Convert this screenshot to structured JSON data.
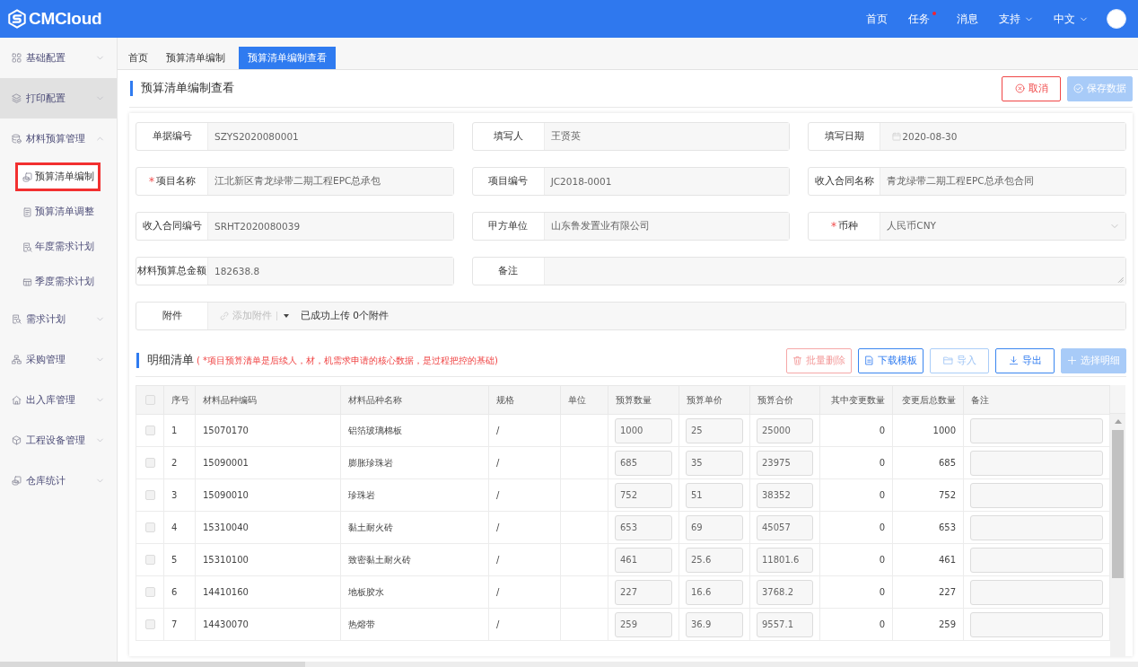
{
  "header": {
    "logo": "CMCloud",
    "nav": [
      {
        "label": "首页",
        "badge": false,
        "dropdown": false
      },
      {
        "label": "任务",
        "badge": true,
        "dropdown": false
      },
      {
        "label": "消息",
        "badge": false,
        "dropdown": false
      },
      {
        "label": "支持",
        "badge": false,
        "dropdown": true
      },
      {
        "label": "中文",
        "badge": false,
        "dropdown": true
      }
    ]
  },
  "sidebar": {
    "items": [
      {
        "label": "基础配置",
        "expanded": false,
        "hovered": false
      },
      {
        "label": "打印配置",
        "expanded": false,
        "hovered": true
      },
      {
        "label": "材料预算管理",
        "expanded": true,
        "hovered": false,
        "children": [
          {
            "label": "预算清单编制",
            "selected": true,
            "outlined": true
          },
          {
            "label": "预算清单调整",
            "selected": false,
            "outlined": false
          },
          {
            "label": "年度需求计划",
            "selected": false,
            "outlined": false
          },
          {
            "label": "季度需求计划",
            "selected": false,
            "outlined": false
          }
        ]
      },
      {
        "label": "需求计划",
        "expanded": false,
        "hovered": false
      },
      {
        "label": "采购管理",
        "expanded": false,
        "hovered": false
      },
      {
        "label": "出入库管理",
        "expanded": false,
        "hovered": false
      },
      {
        "label": "工程设备管理",
        "expanded": false,
        "hovered": false
      },
      {
        "label": "仓库统计",
        "expanded": false,
        "hovered": false
      }
    ]
  },
  "tabs": [
    {
      "label": "首页",
      "selected": false
    },
    {
      "label": "预算清单编制",
      "selected": false
    },
    {
      "label": "预算清单编制查看",
      "selected": true
    }
  ],
  "page": {
    "title": "预算清单编制查看",
    "actions": [
      {
        "label": "取消",
        "kind": "danger",
        "disabled": false
      },
      {
        "label": "保存数据",
        "kind": "solid",
        "disabled": true
      }
    ]
  },
  "form": {
    "fields": [
      {
        "label": "单据编号",
        "value": "SZYS2020080001",
        "required": false,
        "kind": "text"
      },
      {
        "label": "填写人",
        "value": "王贤英",
        "required": false,
        "kind": "text"
      },
      {
        "label": "填写日期",
        "value": "2020-08-30",
        "required": false,
        "kind": "date"
      },
      {
        "label": "项目名称",
        "value": "江北新区青龙绿带二期工程EPC总承包",
        "required": true,
        "kind": "text"
      },
      {
        "label": "项目编号",
        "value": "JC2018-0001",
        "required": false,
        "kind": "text"
      },
      {
        "label": "收入合同名称",
        "value": "青龙绿带二期工程EPC总承包合同",
        "required": false,
        "kind": "text"
      },
      {
        "label": "收入合同编号",
        "value": "SRHT2020080039",
        "required": false,
        "kind": "text"
      },
      {
        "label": "甲方单位",
        "value": "山东鲁发置业有限公司",
        "required": false,
        "kind": "text"
      },
      {
        "label": "币种",
        "value": "人民币CNY",
        "required": true,
        "kind": "select"
      },
      {
        "label": "材料预算总金额",
        "value": "182638.8",
        "required": false,
        "kind": "text"
      },
      {
        "label": "备注",
        "required": false,
        "kind": "textarea"
      },
      {
        "label": "附件",
        "required": false,
        "kind": "attachment",
        "button": "添加附件",
        "status": "已成功上传 0个附件"
      }
    ]
  },
  "detail": {
    "title": "明细清单",
    "note": "( *项目预算清单是后续人，材，机需求申请的核心数据，是过程把控的基础)",
    "actions": [
      {
        "label": "批量删除",
        "kind": "danger",
        "disabled": true
      },
      {
        "label": "下载模板",
        "kind": "outline",
        "disabled": false
      },
      {
        "label": "导入",
        "kind": "outline",
        "disabled": true
      },
      {
        "label": "导出",
        "kind": "outline",
        "disabled": false
      },
      {
        "label": "选择明细",
        "kind": "solid",
        "disabled": true
      }
    ]
  },
  "table": {
    "all_checked": false,
    "columns": [
      {
        "label": "序号",
        "kind": "text"
      },
      {
        "label": "材料品种编码",
        "kind": "text"
      },
      {
        "label": "材料品种名称",
        "kind": "text"
      },
      {
        "label": "规格",
        "kind": "text"
      },
      {
        "label": "单位",
        "kind": "text"
      },
      {
        "label": "预算数量",
        "kind": "input"
      },
      {
        "label": "预算单价",
        "kind": "input"
      },
      {
        "label": "预算合价",
        "kind": "input"
      },
      {
        "label": "其中变更数量",
        "kind": "number"
      },
      {
        "label": "变更后总数量",
        "kind": "number"
      },
      {
        "label": "备注",
        "kind": "input"
      }
    ],
    "rows": [
      {
        "checked": false,
        "index": "1",
        "code": "15070170",
        "name": "铝箔玻璃棉板",
        "spec": "/",
        "qty": "1000",
        "price": "25",
        "amount": "25000",
        "changed": "0",
        "total": "1000"
      },
      {
        "checked": false,
        "index": "2",
        "code": "15090001",
        "name": "膨胀珍珠岩",
        "spec": "/",
        "qty": "685",
        "price": "35",
        "amount": "23975",
        "changed": "0",
        "total": "685"
      },
      {
        "checked": false,
        "index": "3",
        "code": "15090010",
        "name": "珍珠岩",
        "spec": "/",
        "qty": "752",
        "price": "51",
        "amount": "38352",
        "changed": "0",
        "total": "752"
      },
      {
        "checked": false,
        "index": "4",
        "code": "15310040",
        "name": "黏土耐火砖",
        "spec": "/",
        "qty": "653",
        "price": "69",
        "amount": "45057",
        "changed": "0",
        "total": "653"
      },
      {
        "checked": false,
        "index": "5",
        "code": "15310100",
        "name": "致密黏土耐火砖",
        "spec": "/",
        "qty": "461",
        "price": "25.6",
        "amount": "11801.6",
        "changed": "0",
        "total": "461"
      },
      {
        "checked": false,
        "index": "6",
        "code": "14410160",
        "name": "地板胶水",
        "spec": "/",
        "qty": "227",
        "price": "16.6",
        "amount": "3768.2",
        "changed": "0",
        "total": "227"
      },
      {
        "checked": false,
        "index": "7",
        "code": "14430070",
        "name": "热熔带",
        "spec": "/",
        "qty": "259",
        "price": "36.9",
        "amount": "9557.1",
        "changed": "0",
        "total": "259"
      }
    ]
  }
}
